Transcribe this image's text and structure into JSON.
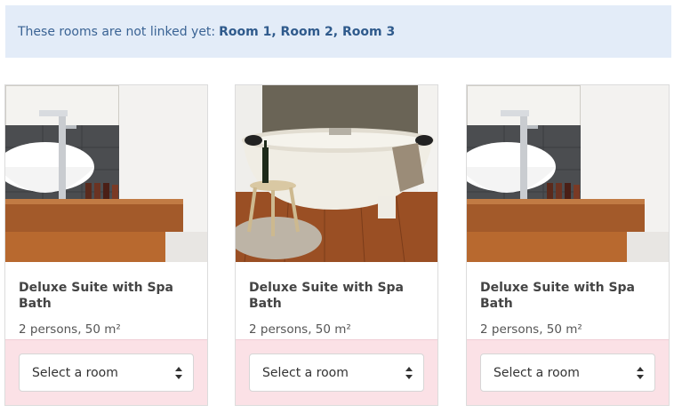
{
  "notice": {
    "text": "These rooms are not linked yet:",
    "rooms": "Room 1, Room 2, Room 3"
  },
  "cards": [
    {
      "title": "Deluxe Suite with Spa Bath",
      "meta": "2 persons, 50 m²",
      "select": "Select a room",
      "image": "bathroom-sink-photo"
    },
    {
      "title": "Deluxe Suite with Spa Bath",
      "meta": "2 persons, 50 m²",
      "select": "Select a room",
      "image": "freestanding-bathtub-photo"
    },
    {
      "title": "Deluxe Suite with Spa Bath",
      "meta": "2 persons, 50 m²",
      "select": "Select a room",
      "image": "bathroom-sink-photo"
    }
  ],
  "colors": {
    "notice_bg": "#e3ecf8",
    "notice_text": "#3a6394",
    "select_bar_bg": "#fbe1e6"
  }
}
